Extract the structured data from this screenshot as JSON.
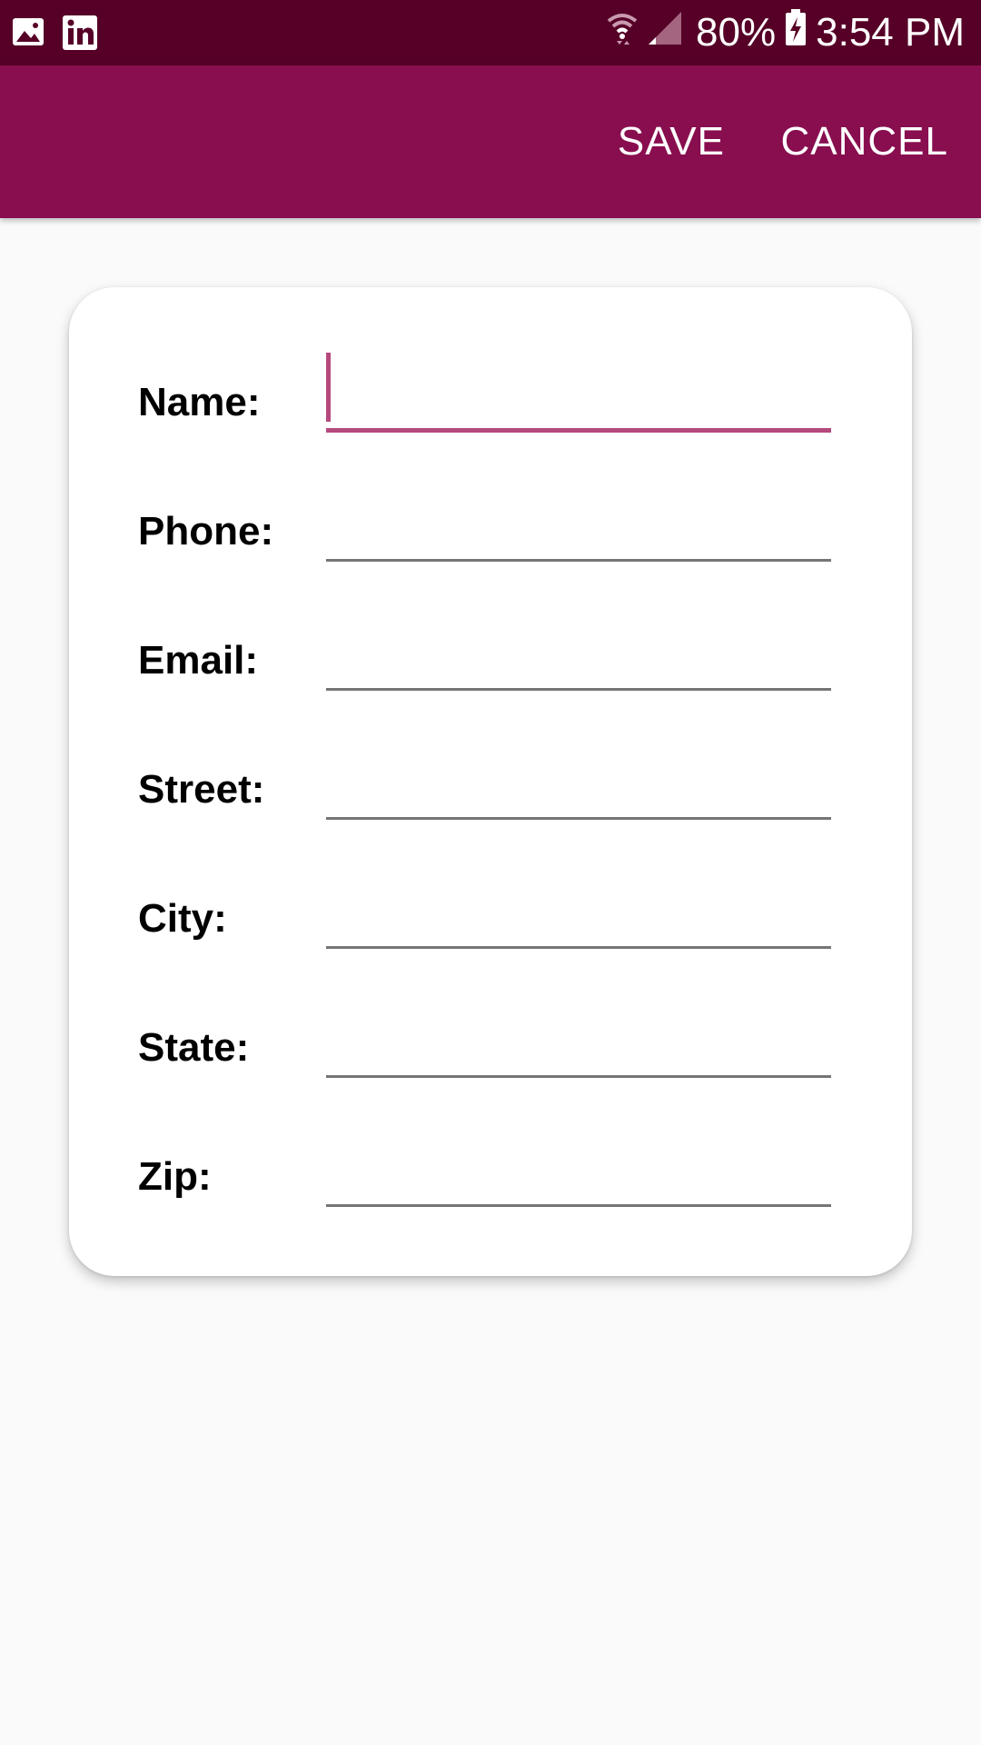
{
  "status_bar": {
    "left_icons": [
      "image-icon",
      "linkedin-icon"
    ],
    "right_icons": [
      "wifi-icon",
      "signal-icon",
      "battery-charging-icon"
    ],
    "battery": "80%",
    "time": "3:54 PM",
    "background": "#560027"
  },
  "app_bar": {
    "background": "#880e4f",
    "save_label": "SAVE",
    "cancel_label": "CANCEL"
  },
  "form": {
    "accent": "#b5497e",
    "fields": [
      {
        "label": "Name:",
        "value": "",
        "focused": true
      },
      {
        "label": "Phone:",
        "value": ""
      },
      {
        "label": "Email:",
        "value": ""
      },
      {
        "label": "Street:",
        "value": ""
      },
      {
        "label": "City:",
        "value": ""
      },
      {
        "label": "State:",
        "value": ""
      },
      {
        "label": "Zip:",
        "value": ""
      }
    ]
  }
}
